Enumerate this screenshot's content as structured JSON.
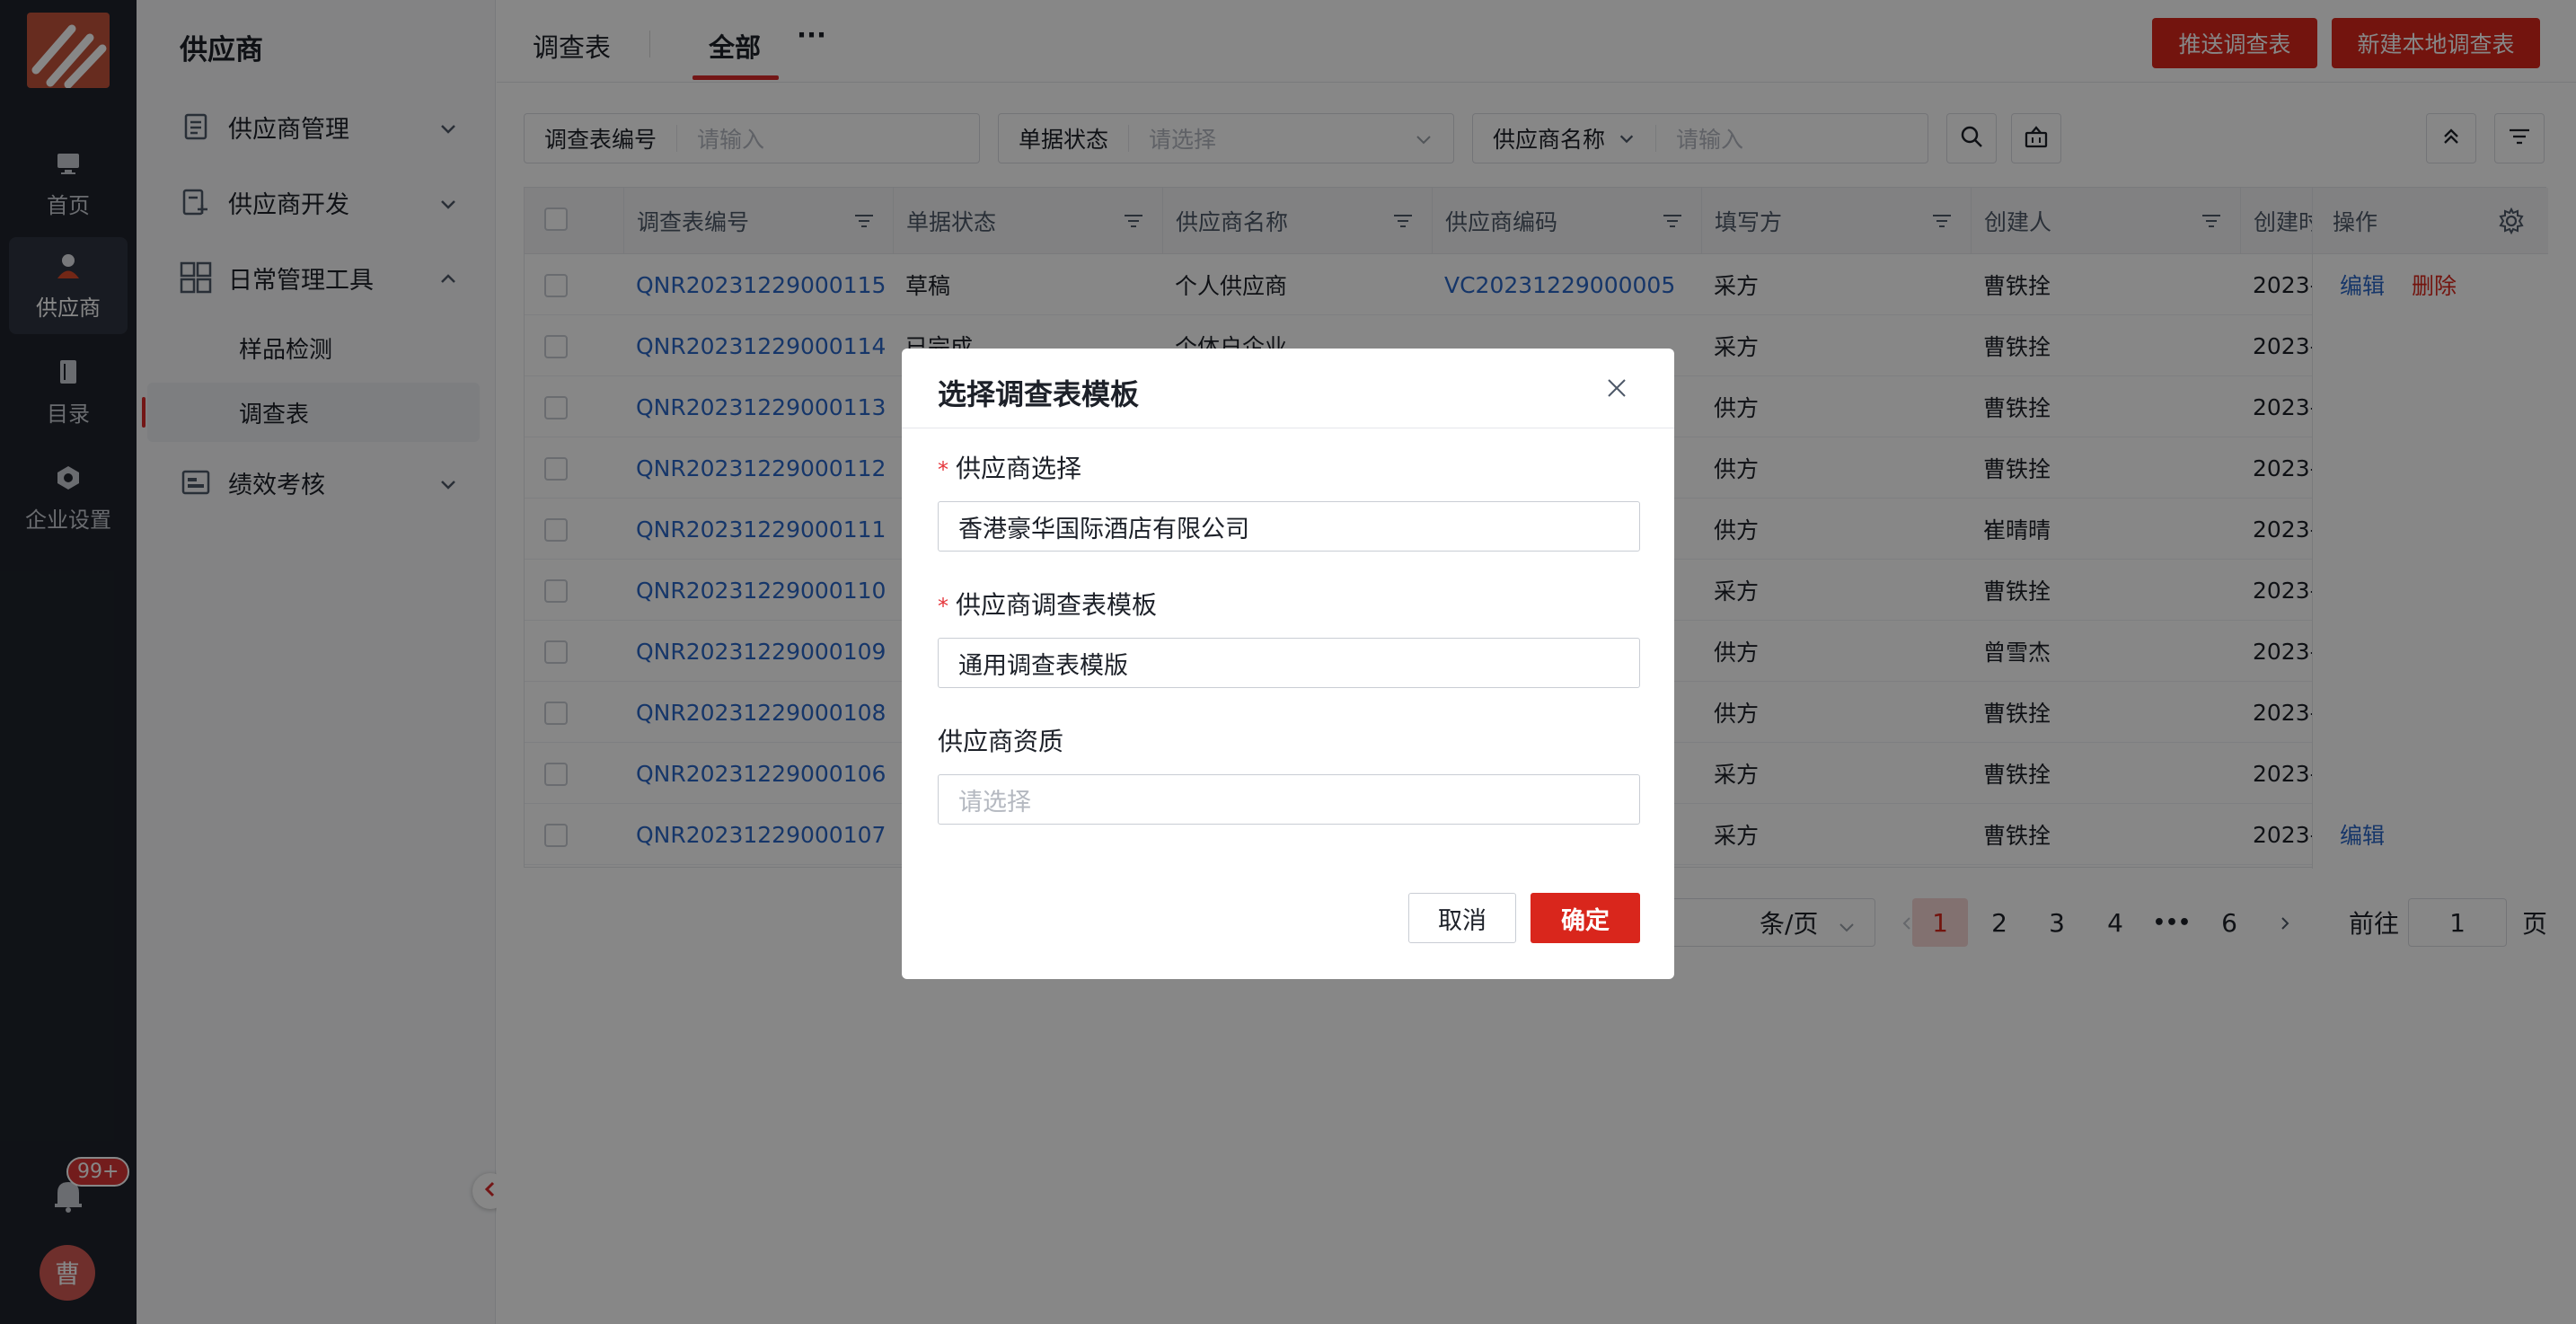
{
  "rail": {
    "items": [
      {
        "label": "首页",
        "icon": "monitor-icon"
      },
      {
        "label": "供应商",
        "icon": "user-icon"
      },
      {
        "label": "目录",
        "icon": "book-icon"
      },
      {
        "label": "企业设置",
        "icon": "hexagon-gear-icon"
      }
    ],
    "badge": "99+",
    "avatar": "曹"
  },
  "nav": {
    "title": "供应商",
    "groups": [
      {
        "label": "供应商管理"
      },
      {
        "label": "供应商开发"
      },
      {
        "label": "日常管理工具"
      },
      {
        "label": "绩效考核"
      }
    ],
    "subitems": [
      {
        "label": "样品检测"
      },
      {
        "label": "调查表"
      }
    ]
  },
  "tabs": {
    "first": "调查表",
    "active": "全部",
    "more": "···"
  },
  "actions": {
    "push": "推送调查表",
    "create": "新建本地调查表"
  },
  "filters": {
    "f1_label": "调查表编号",
    "f1_placeholder": "请输入",
    "f2_label": "单据状态",
    "f2_placeholder": "请选择",
    "f3_label": "供应商名称",
    "f3_placeholder": "请输入"
  },
  "table": {
    "headers": [
      "调查表编号",
      "单据状态",
      "供应商名称",
      "供应商编码",
      "填写方",
      "创建人",
      "创建时",
      "操作"
    ],
    "rows": [
      {
        "id": "QNR20231229000115 ...",
        "status": "草稿",
        "name": "个人供应商",
        "code": "VC20231229000005",
        "filler": "采方",
        "creator": "曹铁拴",
        "created": "2023-",
        "ops": [
          "编辑",
          "删除"
        ]
      },
      {
        "id": "QNR20231229000114 ...",
        "status": "已完成",
        "name": "个体户企业",
        "code": "",
        "filler": "采方",
        "creator": "曹铁拴",
        "created": "2023-",
        "ops": []
      },
      {
        "id": "QNR20231229000113 ...",
        "status": "",
        "name": "",
        "code": "",
        "filler": "供方",
        "creator": "曹铁拴",
        "created": "2023-",
        "ops": []
      },
      {
        "id": "QNR20231229000112 ...",
        "status": "",
        "name": "",
        "code": "",
        "filler": "供方",
        "creator": "曹铁拴",
        "created": "2023-",
        "ops": []
      },
      {
        "id": "QNR20231229000111 ...",
        "status": "",
        "name": "",
        "code": "",
        "filler": "供方",
        "creator": "崔晴晴",
        "created": "2023-",
        "ops": []
      },
      {
        "id": "QNR20231229000110 ...",
        "status": "",
        "name": "",
        "code": "",
        "filler": "采方",
        "creator": "曹铁拴",
        "created": "2023-",
        "ops": []
      },
      {
        "id": "QNR20231229000109 ...",
        "status": "",
        "name": "",
        "code": "",
        "filler": "供方",
        "creator": "曾雪杰",
        "created": "2023-",
        "ops": []
      },
      {
        "id": "QNR20231229000108 ...",
        "status": "",
        "name": "",
        "code": "",
        "filler": "供方",
        "creator": "曹铁拴",
        "created": "2023-",
        "ops": []
      },
      {
        "id": "QNR20231229000106 ...",
        "status": "",
        "name": "",
        "code": "",
        "filler": "采方",
        "creator": "曹铁拴",
        "created": "2023-",
        "ops": []
      },
      {
        "id": "QNR20231229000107 ...",
        "status": "",
        "name": "",
        "code": "",
        "filler": "采方",
        "creator": "曹铁拴",
        "created": "2023-",
        "ops": [
          "编辑"
        ]
      }
    ]
  },
  "pagination": {
    "per_page": "条/页",
    "pages": [
      "1",
      "2",
      "3",
      "4",
      "6"
    ],
    "ellipsis": "•••",
    "current": "1",
    "goto_label": "前往",
    "goto_value": "1",
    "page_suffix": "页"
  },
  "modal": {
    "title": "选择调查表模板",
    "required_mark": "*",
    "supplier_label": "供应商选择",
    "supplier_value": "香港豪华国际酒店有限公司",
    "template_label": "供应商调查表模板",
    "template_value": "通用调查表模版",
    "qual_label": "供应商资质",
    "qual_placeholder": "请选择",
    "cancel": "取消",
    "confirm": "确定"
  },
  "colors": {
    "accent": "#d9261c",
    "link": "#2a66c6",
    "rail": "#1f232c"
  }
}
